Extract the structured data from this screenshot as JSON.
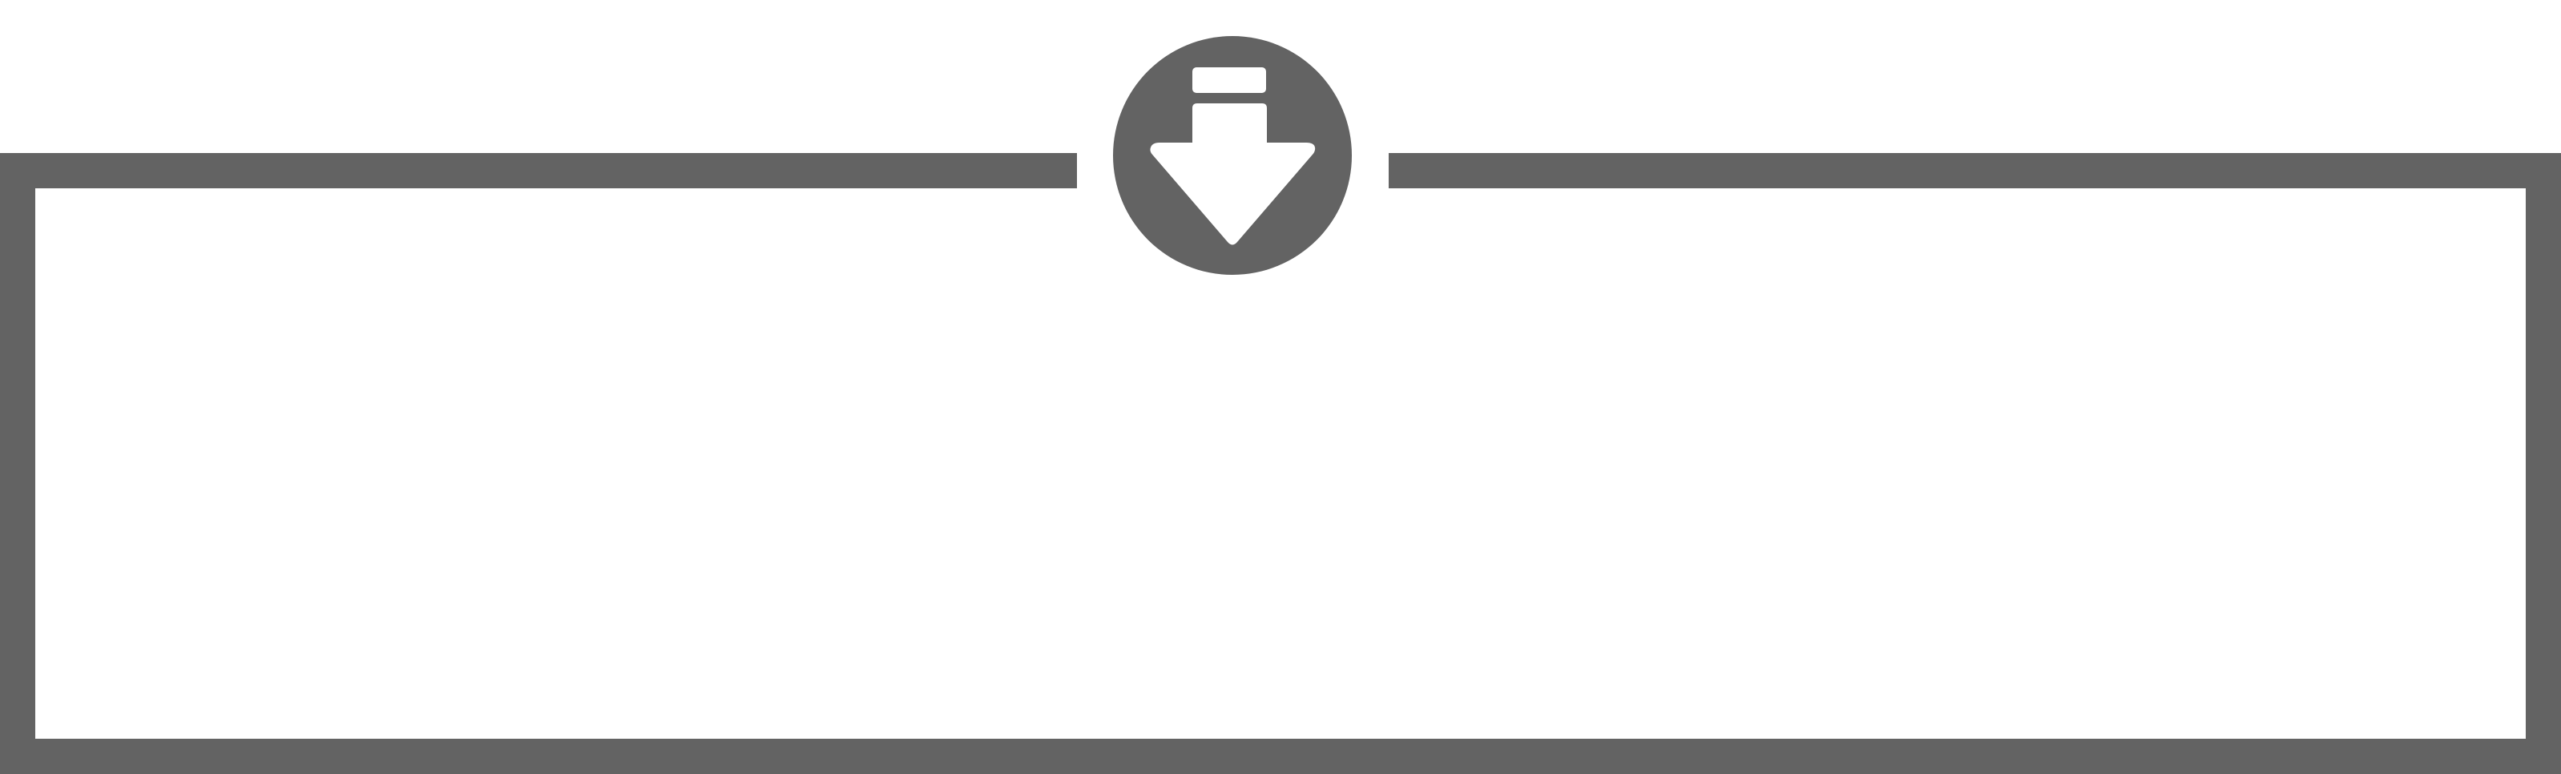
{
  "dropzone": {
    "icon": "download-arrow-icon",
    "colors": {
      "frame": "#636363",
      "background": "#ffffff",
      "icon_glyph": "#ffffff"
    }
  }
}
